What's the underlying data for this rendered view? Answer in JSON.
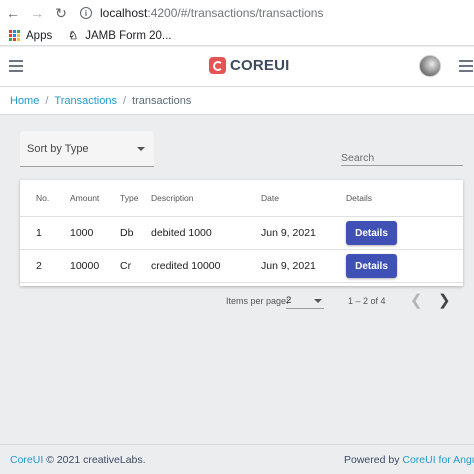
{
  "browser": {
    "url_host": "localhost",
    "url_path": ":4200/#/transactions/transactions",
    "bookmarks": [
      "Apps",
      "JAMB Form 20..."
    ]
  },
  "header": {
    "brand": "COREUI"
  },
  "breadcrumb": {
    "home": "Home",
    "section": "Transactions",
    "current": "transactions",
    "separator": "/"
  },
  "controls": {
    "sort_label": "Sort by Type",
    "search_placeholder": "Search"
  },
  "table": {
    "headers": {
      "no": "No.",
      "amount": "Amount",
      "type": "Type",
      "description": "Description",
      "date": "Date",
      "details": "Details"
    },
    "rows": [
      {
        "no": "1",
        "amount": "1000",
        "type": "Db",
        "description": "debited 1000",
        "date": "Jun 9, 2021",
        "action": "Details"
      },
      {
        "no": "2",
        "amount": "10000",
        "type": "Cr",
        "description": "credited 10000",
        "date": "Jun 9, 2021",
        "action": "Details"
      }
    ]
  },
  "paginator": {
    "items_per_page_label": "Items per page:",
    "page_size": "2",
    "range": "1 – 2 of 4"
  },
  "footer": {
    "brand_link": "CoreUI",
    "copyright": "© 2021 creativeLabs.",
    "powered_by": "Powered by",
    "powered_link": "CoreUI for Angular"
  },
  "colors": {
    "accent_link": "#1f9bcf",
    "details_button": "#3f51b5",
    "brand_logo": "#e55353"
  }
}
